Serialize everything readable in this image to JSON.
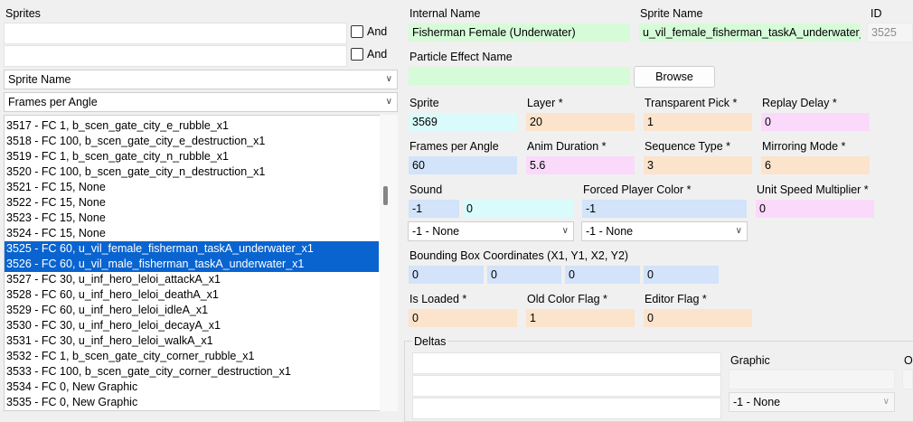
{
  "sprites_panel": {
    "title": "Sprites",
    "search1_value": "",
    "search2_value": "",
    "and_label": "And",
    "filter1_selected": "Sprite Name",
    "filter2_selected": "Frames per Angle",
    "items": [
      {
        "text": "3517 - FC 1, b_scen_gate_city_e_rubble_x1",
        "selected": false
      },
      {
        "text": "3518 - FC 100, b_scen_gate_city_e_destruction_x1",
        "selected": false
      },
      {
        "text": "3519 - FC 1, b_scen_gate_city_n_rubble_x1",
        "selected": false
      },
      {
        "text": "3520 - FC 100, b_scen_gate_city_n_destruction_x1",
        "selected": false
      },
      {
        "text": "3521 - FC 15, None",
        "selected": false
      },
      {
        "text": "3522 - FC 15, None",
        "selected": false
      },
      {
        "text": "3523 - FC 15, None",
        "selected": false
      },
      {
        "text": "3524 - FC 15, None",
        "selected": false
      },
      {
        "text": "3525 - FC 60, u_vil_female_fisherman_taskA_underwater_x1",
        "selected": true
      },
      {
        "text": "3526 - FC 60, u_vil_male_fisherman_taskA_underwater_x1",
        "selected": true
      },
      {
        "text": "3527 - FC 30, u_inf_hero_leloi_attackA_x1",
        "selected": false
      },
      {
        "text": "3528 - FC 60, u_inf_hero_leloi_deathA_x1",
        "selected": false
      },
      {
        "text": "3529 - FC 60, u_inf_hero_leloi_idleA_x1",
        "selected": false
      },
      {
        "text": "3530 - FC 30, u_inf_hero_leloi_decayA_x1",
        "selected": false
      },
      {
        "text": "3531 - FC 30, u_inf_hero_leloi_walkA_x1",
        "selected": false
      },
      {
        "text": "3532 - FC 1, b_scen_gate_city_corner_rubble_x1",
        "selected": false
      },
      {
        "text": "3533 - FC 100, b_scen_gate_city_corner_destruction_x1",
        "selected": false
      },
      {
        "text": "3534 - FC 0, New Graphic",
        "selected": false
      },
      {
        "text": "3535 - FC 0, New Graphic",
        "selected": false
      }
    ]
  },
  "details": {
    "internal_name_label": "Internal Name",
    "internal_name_value": "Fisherman Female (Underwater)",
    "sprite_name_label": "Sprite Name",
    "sprite_name_value": "u_vil_female_fisherman_taskA_underwater_",
    "id_label": "ID",
    "id_value": "3525",
    "particle_label": "Particle Effect Name",
    "particle_value": "",
    "browse_label": "Browse",
    "sprite_label": "Sprite",
    "sprite_value": "3569",
    "layer_label": "Layer *",
    "layer_value": "20",
    "transparent_pick_label": "Transparent Pick *",
    "transparent_pick_value": "1",
    "replay_delay_label": "Replay Delay *",
    "replay_delay_value": "0",
    "frames_per_angle_label": "Frames per Angle",
    "frames_per_angle_value": "60",
    "anim_duration_label": "Anim Duration *",
    "anim_duration_value": "5.6",
    "sequence_type_label": "Sequence Type *",
    "sequence_type_value": "3",
    "mirroring_mode_label": "Mirroring Mode *",
    "mirroring_mode_value": "6",
    "sound_label": "Sound",
    "sound_value1": "-1",
    "sound_value2": "0",
    "sound_dropdown": "-1 - None",
    "forced_player_color_label": "Forced Player Color *",
    "forced_player_color_value": "-1",
    "forced_player_color_dropdown": "-1 - None",
    "unit_speed_label": "Unit Speed Multiplier *",
    "unit_speed_value": "0",
    "bbox_label": "Bounding Box Coordinates (X1, Y1, X2, Y2)",
    "bbox_x1": "0",
    "bbox_y1": "0",
    "bbox_x2": "0",
    "bbox_y2": "0",
    "is_loaded_label": "Is Loaded *",
    "is_loaded_value": "0",
    "old_color_flag_label": "Old Color Flag *",
    "old_color_flag_value": "1",
    "editor_flag_label": "Editor Flag *",
    "editor_flag_value": "0"
  },
  "deltas": {
    "title": "Deltas",
    "graphic_label": "Graphic",
    "graphic_value": "",
    "graphic_dropdown": "-1 - None",
    "cut_label": "O"
  },
  "colors": {
    "selection": "#0a64d0",
    "green_field": "#d6fbd8",
    "cyan_field": "#d9fbfb",
    "peach_field": "#fce3cc",
    "pink_field": "#fbd9fb",
    "blue_field": "#d2e3fa"
  }
}
